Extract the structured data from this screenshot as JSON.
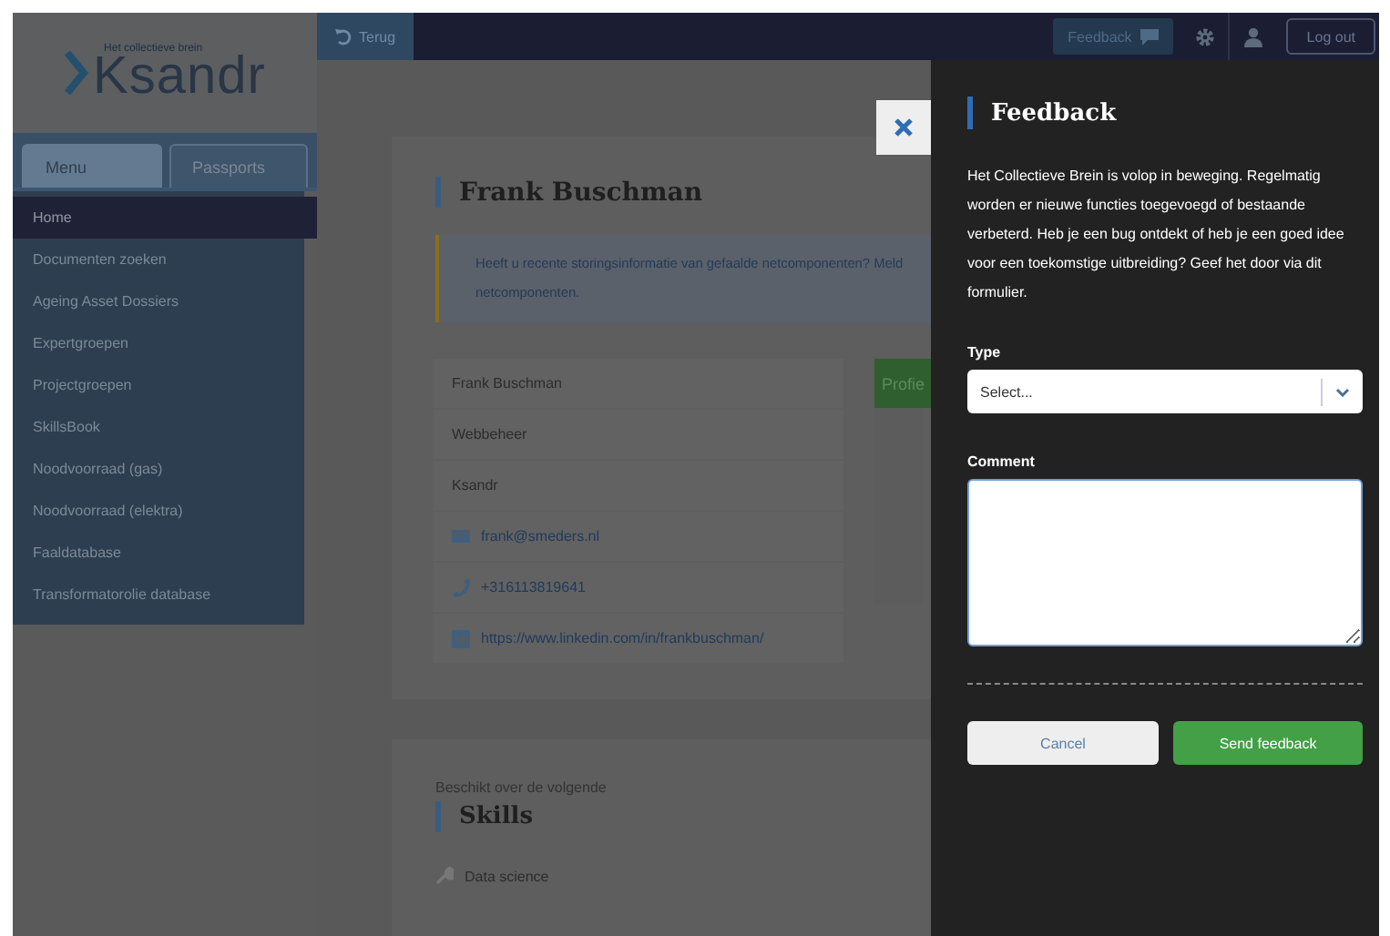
{
  "sidebar": {
    "logo": {
      "text": "Ksandr",
      "tagline": "Het collectieve brein"
    },
    "tabs": [
      {
        "label": "Menu",
        "selected": true
      },
      {
        "label": "Passports",
        "selected": false
      }
    ],
    "items": [
      {
        "label": "Home",
        "selected": true
      },
      {
        "label": "Documenten zoeken",
        "selected": false
      },
      {
        "label": "Ageing Asset Dossiers",
        "selected": false
      },
      {
        "label": "Expertgroepen",
        "selected": false
      },
      {
        "label": "Projectgroepen",
        "selected": false
      },
      {
        "label": "SkillsBook",
        "selected": false
      },
      {
        "label": "Noodvoorraad (gas)",
        "selected": false
      },
      {
        "label": "Noodvoorraad (elektra)",
        "selected": false
      },
      {
        "label": "Faaldatabase",
        "selected": false
      },
      {
        "label": "Transformatorolie database",
        "selected": false
      }
    ]
  },
  "topbar": {
    "back": "Terug",
    "feedback": "Feedback",
    "logout": "Log out"
  },
  "profile": {
    "name": "Frank Buschman",
    "alert": [
      "Heeft u recente storingsinformatie van gefaalde netcomponenten? Meld",
      "netcomponenten."
    ],
    "details": [
      {
        "kind": "text",
        "value": "Frank Buschman"
      },
      {
        "kind": "text",
        "value": "Webbeheer"
      },
      {
        "kind": "text",
        "value": "Ksandr"
      },
      {
        "kind": "email",
        "value": "frank@smeders.nl"
      },
      {
        "kind": "phone",
        "value": "+316113819641"
      },
      {
        "kind": "linkedin",
        "value": "https://www.linkedin.com/in/frankbuschman/"
      }
    ],
    "action": "Profie"
  },
  "skills": {
    "intro": "Beschikt over de volgende",
    "title": "Skills",
    "items": [
      "Data science"
    ]
  },
  "feedback_panel": {
    "title": "Feedback",
    "description": "Het Collectieve Brein is volop in beweging. Regelmatig worden er nieuwe functies toegevoegd of bestaande verbeterd. Heb je een bug ontdekt of heb je een goed idee voor een toekomstige uitbreiding? Geef het door via dit formulier.",
    "type": {
      "label": "Type",
      "placeholder": "Select..."
    },
    "comment": {
      "label": "Comment"
    },
    "buttons": [
      {
        "label": "Cancel",
        "kind": "secondary"
      },
      {
        "label": "Send feedback",
        "kind": "primary"
      }
    ]
  }
}
